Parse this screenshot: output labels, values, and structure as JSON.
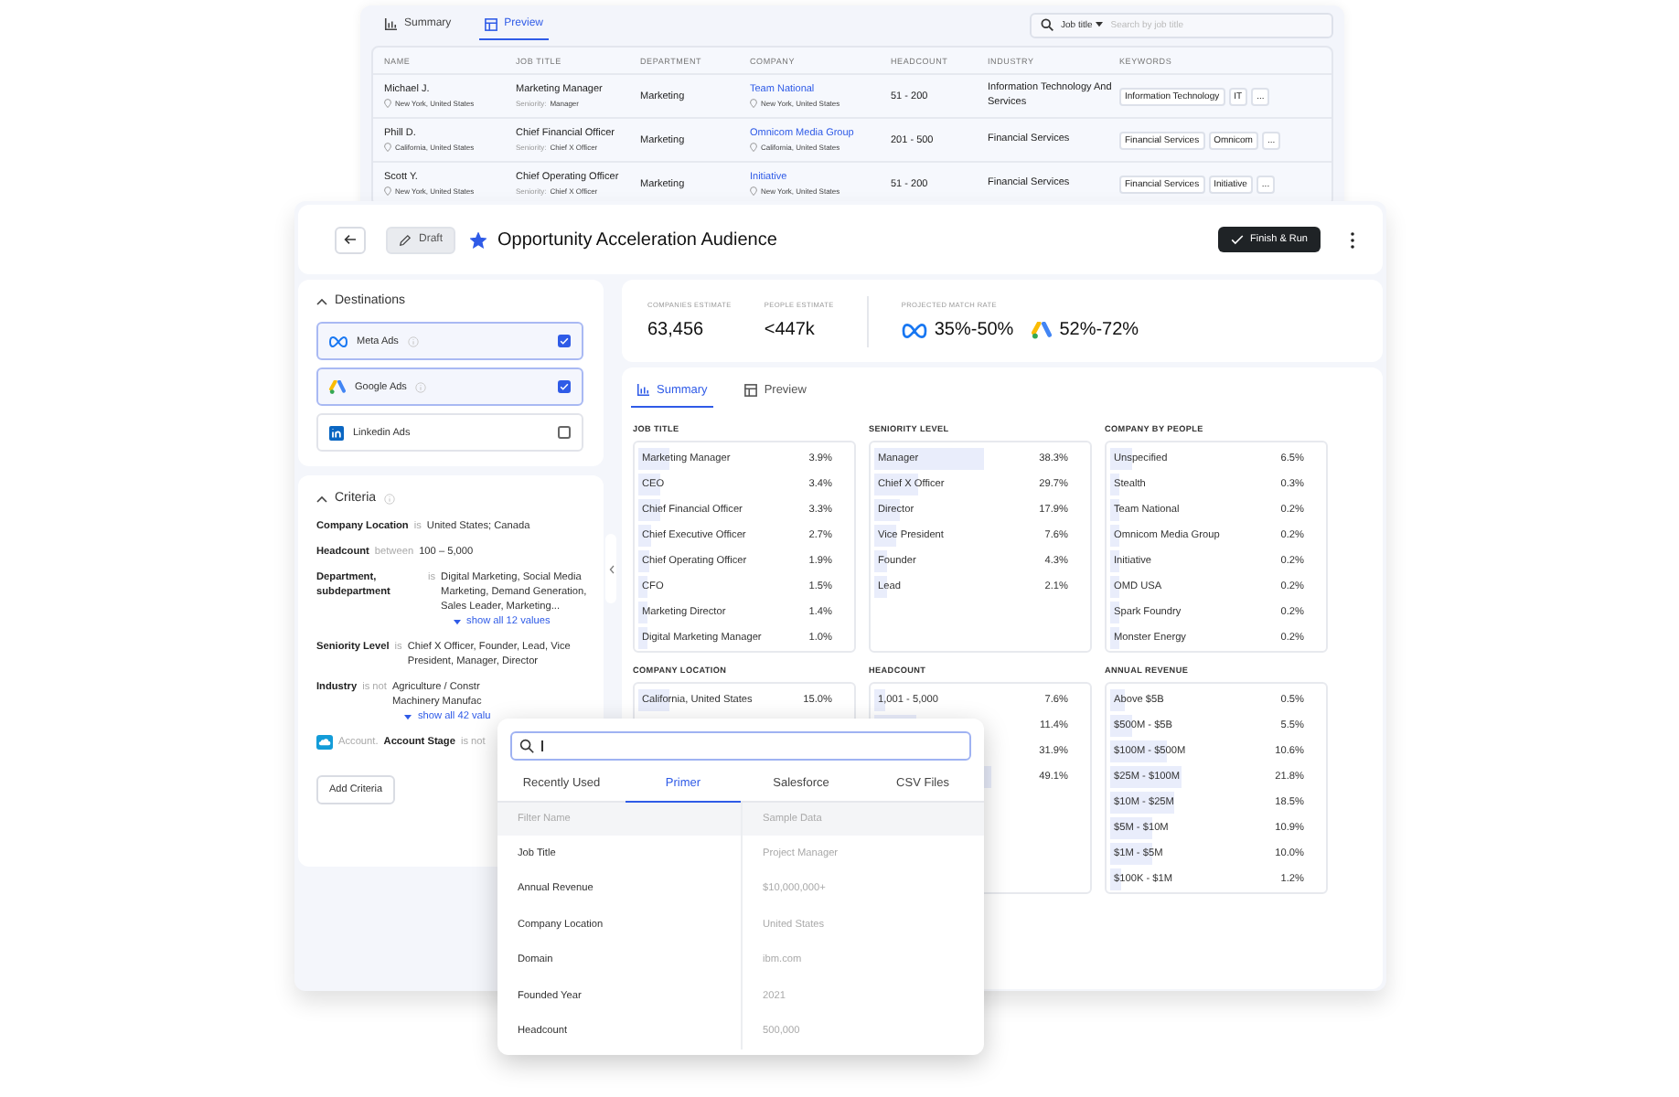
{
  "background_window": {
    "tabs": [
      {
        "label": "Summary",
        "selected": false
      },
      {
        "label": "Preview",
        "selected": true
      }
    ],
    "search": {
      "filter": "Job title",
      "placeholder": "Search by job title"
    },
    "table": {
      "columns": [
        "NAME",
        "JOB TITLE",
        "DEPARTMENT",
        "COMPANY",
        "HEADCOUNT",
        "INDUSTRY",
        "KEYWORDS"
      ],
      "rows": [
        {
          "name": "Michael J.",
          "location": "New York, United States",
          "job_title": "Marketing Manager",
          "seniority_label": "Seniority:",
          "seniority": "Manager",
          "department": "Marketing",
          "company": "Team National",
          "company_location": "New York, United States",
          "headcount": "51 - 200",
          "industry": "Information Technology And Services",
          "keywords": [
            "Information Technology",
            "IT",
            "..."
          ]
        },
        {
          "name": "Phill D.",
          "location": "California, United States",
          "job_title": "Chief Financial Officer",
          "seniority_label": "Seniority:",
          "seniority": "Chief X Officer",
          "department": "Marketing",
          "company": "Omnicom Media Group",
          "company_location": "California, United States",
          "headcount": "201 - 500",
          "industry": "Financial Services",
          "keywords": [
            "Financial Services",
            "Omnicom",
            "..."
          ]
        },
        {
          "name": "Scott Y.",
          "location": "New York, United States",
          "job_title": "Chief Operating Officer",
          "seniority_label": "Seniority:",
          "seniority": "Chief X Officer",
          "department": "Marketing",
          "company": "Initiative",
          "company_location": "New York, United States",
          "headcount": "51 - 200",
          "industry": "Financial Services",
          "keywords": [
            "Financial Services",
            "Initiative",
            "..."
          ]
        }
      ]
    }
  },
  "header": {
    "status": "Draft",
    "starred": true,
    "title": "Opportunity Acceleration Audience",
    "primary_button": "Finish & Run"
  },
  "destinations": {
    "title": "Destinations",
    "expanded": true,
    "items": [
      {
        "kind": "meta",
        "label": "Meta Ads",
        "checked": true
      },
      {
        "kind": "google",
        "label": "Google Ads",
        "checked": true
      },
      {
        "kind": "linkedin",
        "label": "Linkedin Ads",
        "checked": false
      }
    ]
  },
  "criteria": {
    "title": "Criteria",
    "expanded": true,
    "items": [
      {
        "kind": "basic",
        "field": "Company Location",
        "operator": "is",
        "value": "United States; Canada"
      },
      {
        "kind": "basic",
        "field": "Headcount",
        "operator": "between",
        "value": "100 – 5,000"
      },
      {
        "kind": "basic",
        "field": "Department, subdepartment",
        "operator": "is",
        "value": "Digital Marketing, Social Media Marketing, Demand Generation, Sales Leader, Marketing...",
        "link": "show all 12 values"
      },
      {
        "kind": "basic",
        "field": "Seniority Level",
        "operator": "is",
        "value": "Chief X Officer, Founder, Lead, Vice President, Manager, Director"
      },
      {
        "kind": "basic",
        "field": "Industry",
        "operator": "is not",
        "value_lines": [
          "Agriculture / Constr",
          "Machinery Manufac"
        ],
        "link": "show all 42 valu"
      },
      {
        "kind": "crm",
        "object": "Account.",
        "field": "Account Stage",
        "operator": "is not"
      }
    ],
    "add_button": "Add Criteria"
  },
  "estimates": [
    {
      "label": "COMPANIES ESTIMATE",
      "value": "63,456"
    },
    {
      "label": "PEOPLE ESTIMATE",
      "value": "<447k"
    }
  ],
  "match_rate": {
    "label": "PROJECTED MATCH RATE",
    "items": [
      {
        "kind": "meta",
        "value": "35%-50%"
      },
      {
        "kind": "google",
        "value": "52%-72%"
      }
    ]
  },
  "summary": {
    "tabs": [
      {
        "label": "Summary",
        "selected": true
      },
      {
        "label": "Preview",
        "selected": false
      }
    ],
    "panels": [
      {
        "title": "JOB TITLE",
        "items": [
          {
            "label": "Marketing Manager",
            "value": "3.9%",
            "level": 0.15
          },
          {
            "label": "CEO",
            "value": "3.4%",
            "level": 0.1
          },
          {
            "label": "Chief Financial Officer",
            "value": "3.3%",
            "level": 0.1
          },
          {
            "label": "Chief Executive Officer",
            "value": "2.7%",
            "level": 0.06
          },
          {
            "label": "Chief Operating Officer",
            "value": "1.9%",
            "level": 0.05
          },
          {
            "label": "CFO",
            "value": "1.5%",
            "level": 0.04
          },
          {
            "label": "Marketing Director",
            "value": "1.4%",
            "level": 0.04
          },
          {
            "label": "Digital Marketing Manager",
            "value": "1.0%",
            "level": 0.04
          }
        ]
      },
      {
        "title": "SENIORITY LEVEL",
        "items": [
          {
            "label": "Manager",
            "value": "38.3%",
            "level": 0.52
          },
          {
            "label": "Chief X Officer",
            "value": "29.7%",
            "level": 0.21
          },
          {
            "label": "Director",
            "value": "17.9%",
            "level": 0.12
          },
          {
            "label": "Vice President",
            "value": "7.6%",
            "level": 0.1
          },
          {
            "label": "Founder",
            "value": "4.3%",
            "level": 0.06
          },
          {
            "label": "Lead",
            "value": "2.1%",
            "level": 0.06
          }
        ]
      },
      {
        "title": "COMPANY BY PEOPLE",
        "items": [
          {
            "label": "Unspecified",
            "value": "6.5%",
            "level": 0.1
          },
          {
            "label": "Stealth",
            "value": "0.3%",
            "level": 0.04
          },
          {
            "label": "Team National",
            "value": "0.2%",
            "level": 0.04
          },
          {
            "label": "Omnicom Media Group",
            "value": "0.2%",
            "level": 0.04
          },
          {
            "label": "Initiative",
            "value": "0.2%",
            "level": 0.04
          },
          {
            "label": "OMD USA",
            "value": "0.2%",
            "level": 0.04
          },
          {
            "label": "Spark Foundry",
            "value": "0.2%",
            "level": 0.04
          },
          {
            "label": "Monster Energy",
            "value": "0.2%",
            "level": 0.04
          }
        ]
      },
      {
        "title": "COMPANY LOCATION",
        "items": [
          {
            "label": "California, United States",
            "value": "15.0%",
            "level": 0.15
          }
        ]
      },
      {
        "title": "HEADCOUNT",
        "items": [
          {
            "label": "1,001 - 5,000",
            "value": "7.6%",
            "level": 0.05
          },
          {
            "value": "11.4%",
            "level": 0.2
          },
          {
            "value": "31.9%"
          },
          {
            "value": "49.1%",
            "level": 0.55
          }
        ]
      },
      {
        "title": "ANNUAL REVENUE",
        "items": [
          {
            "label": "Above $5B",
            "value": "0.5%",
            "level": 0.07
          },
          {
            "label": "$500M - $5B",
            "value": "5.5%",
            "level": 0.1
          },
          {
            "label": "$100M - $500M",
            "value": "10.6%",
            "level": 0.27
          },
          {
            "label": "$25M - $100M",
            "value": "21.8%",
            "level": 0.34
          },
          {
            "label": "$10M - $25M",
            "value": "18.5%",
            "level": 0.3
          },
          {
            "label": "$5M - $10M",
            "value": "10.9%",
            "level": 0.2
          },
          {
            "label": "$1M - $5M",
            "value": "10.0%",
            "level": 0.2
          },
          {
            "label": "$100K - $1M",
            "value": "1.2%",
            "level": 0.05
          }
        ]
      }
    ]
  },
  "filter_popup": {
    "tabs": [
      {
        "label": "Recently Used",
        "selected": false
      },
      {
        "label": "Primer",
        "selected": true
      },
      {
        "label": "Salesforce",
        "selected": false
      },
      {
        "label": "CSV Files",
        "selected": false
      }
    ],
    "columns": [
      "Filter Name",
      "Sample Data"
    ],
    "rows": [
      {
        "name": "Job Title",
        "sample": "Project Manager"
      },
      {
        "name": "Annual Revenue",
        "sample": "$10,000,000+"
      },
      {
        "name": "Company Location",
        "sample": "United States"
      },
      {
        "name": "Domain",
        "sample": "ibm.com"
      },
      {
        "name": "Founded Year",
        "sample": "2021"
      },
      {
        "name": "Headcount",
        "sample": "500,000"
      }
    ]
  }
}
